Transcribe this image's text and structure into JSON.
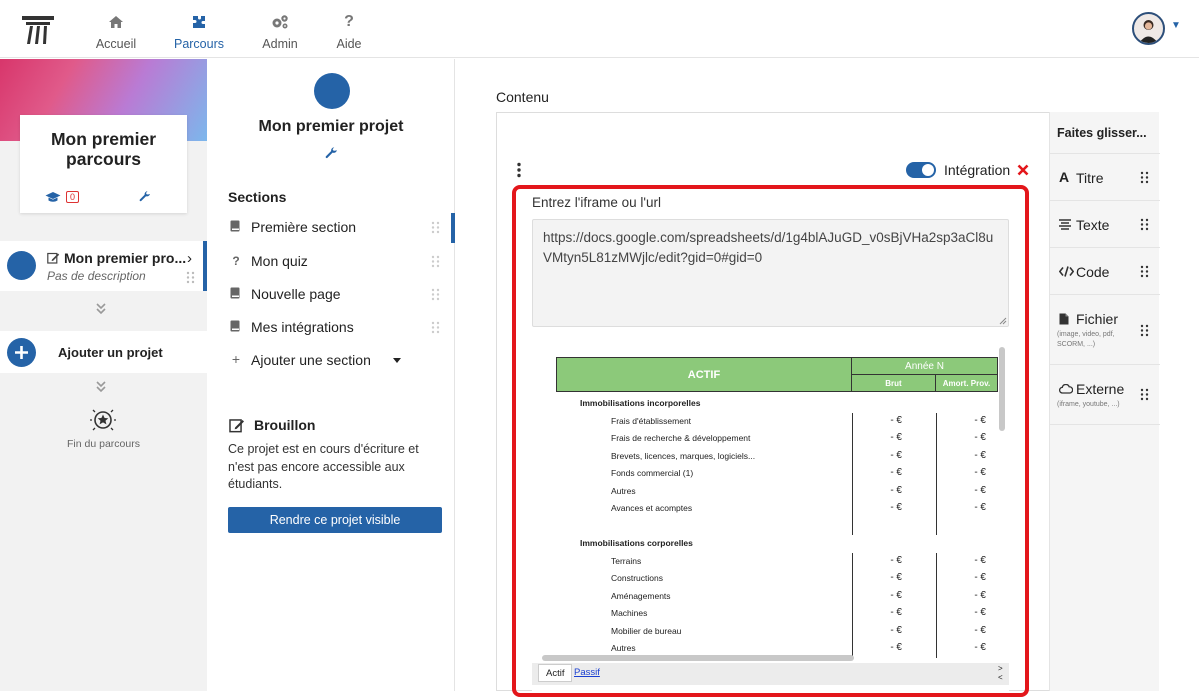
{
  "nav": {
    "items": [
      {
        "label": "Accueil",
        "icon": "home-icon"
      },
      {
        "label": "Parcours",
        "icon": "puzzle-icon"
      },
      {
        "label": "Admin",
        "icon": "gears-icon"
      },
      {
        "label": "Aide",
        "icon": "question-icon",
        "glyph": "?"
      }
    ],
    "active": "Parcours",
    "accent_color": "#2563a7"
  },
  "left": {
    "course_title": "Mon premier parcours",
    "badge_count": "0",
    "project": {
      "title": "Mon premier pro...",
      "description": "Pas de description"
    },
    "add_project": "Ajouter un projet",
    "end_label": "Fin du parcours",
    "chevrons": "»"
  },
  "mid": {
    "title": "Mon premier projet",
    "sections_heading": "Sections",
    "sections": [
      {
        "label": "Première section",
        "icon": "book-icon",
        "selected": true
      },
      {
        "label": "Mon quiz",
        "icon": "question-icon",
        "glyph": "?"
      },
      {
        "label": "Nouvelle page",
        "icon": "book-icon"
      },
      {
        "label": "Mes intégrations",
        "icon": "book-icon"
      },
      {
        "label": "Ajouter une section",
        "icon": "plus-icon",
        "glyph": "+"
      }
    ],
    "draft": {
      "heading": "Brouillon",
      "text": "Ce projet est en cours d'écriture et n'est pas encore accessible aux étudiants.",
      "button": "Rendre ce projet visible"
    }
  },
  "content": {
    "heading": "Contenu",
    "block_label": "Intégration",
    "iframe_label": "Entrez l'iframe ou l'url",
    "url_value": "https://docs.google.com/spreadsheets/d/1g4blAJuGD_v0sBjVHa2sp3aCl8uVMtyn5L81zMWjlc/edit?gid=0#gid=0",
    "toggle_on": true,
    "sheet": {
      "header": "ACTIF",
      "year_header": "Année N",
      "col1": "Brut",
      "col2": "Amort. Prov.",
      "rows": [
        {
          "type": "cat",
          "label": "Immobilisations incorporelles"
        },
        {
          "type": "item",
          "label": "Frais d'établissement",
          "v1": "- €",
          "v2": "- €"
        },
        {
          "type": "item",
          "label": "Frais de recherche & développement",
          "v1": "- €",
          "v2": "- €"
        },
        {
          "type": "item",
          "label": "Brevets, licences, marques, logiciels...",
          "v1": "- €",
          "v2": "- €"
        },
        {
          "type": "item",
          "label": "Fonds commercial (1)",
          "v1": "- €",
          "v2": "- €"
        },
        {
          "type": "item",
          "label": "Autres",
          "v1": "- €",
          "v2": "- €"
        },
        {
          "type": "item",
          "label": "Avances et acomptes",
          "v1": "- €",
          "v2": "- €"
        },
        {
          "type": "blank",
          "label": ""
        },
        {
          "type": "cat",
          "label": "Immobilisations corporelles"
        },
        {
          "type": "item",
          "label": "Terrains",
          "v1": "- €",
          "v2": "- €"
        },
        {
          "type": "item",
          "label": "Constructions",
          "v1": "- €",
          "v2": "- €"
        },
        {
          "type": "item",
          "label": "Aménagements",
          "v1": "- €",
          "v2": "- €"
        },
        {
          "type": "item",
          "label": "Machines",
          "v1": "- €",
          "v2": "- €"
        },
        {
          "type": "item",
          "label": "Mobilier de bureau",
          "v1": "- €",
          "v2": "- €"
        },
        {
          "type": "item",
          "label": "Autres",
          "v1": "- €",
          "v2": "- €"
        }
      ],
      "tabs": [
        "Actif",
        "Passif"
      ],
      "header_color": "#8cc97a"
    }
  },
  "panel": {
    "heading": "Faites glisser...",
    "items": [
      {
        "label": "Titre",
        "icon": "font-icon",
        "glyph": "A",
        "sub": ""
      },
      {
        "label": "Texte",
        "icon": "align-icon",
        "sub": ""
      },
      {
        "label": "Code",
        "icon": "code-icon",
        "sub": ""
      },
      {
        "label": "Fichier",
        "icon": "file-icon",
        "sub": "(image, video, pdf, SCORM, ...)"
      },
      {
        "label": "Externe",
        "icon": "cloud-icon",
        "sub": "(iframe, youtube, ...)"
      }
    ]
  }
}
